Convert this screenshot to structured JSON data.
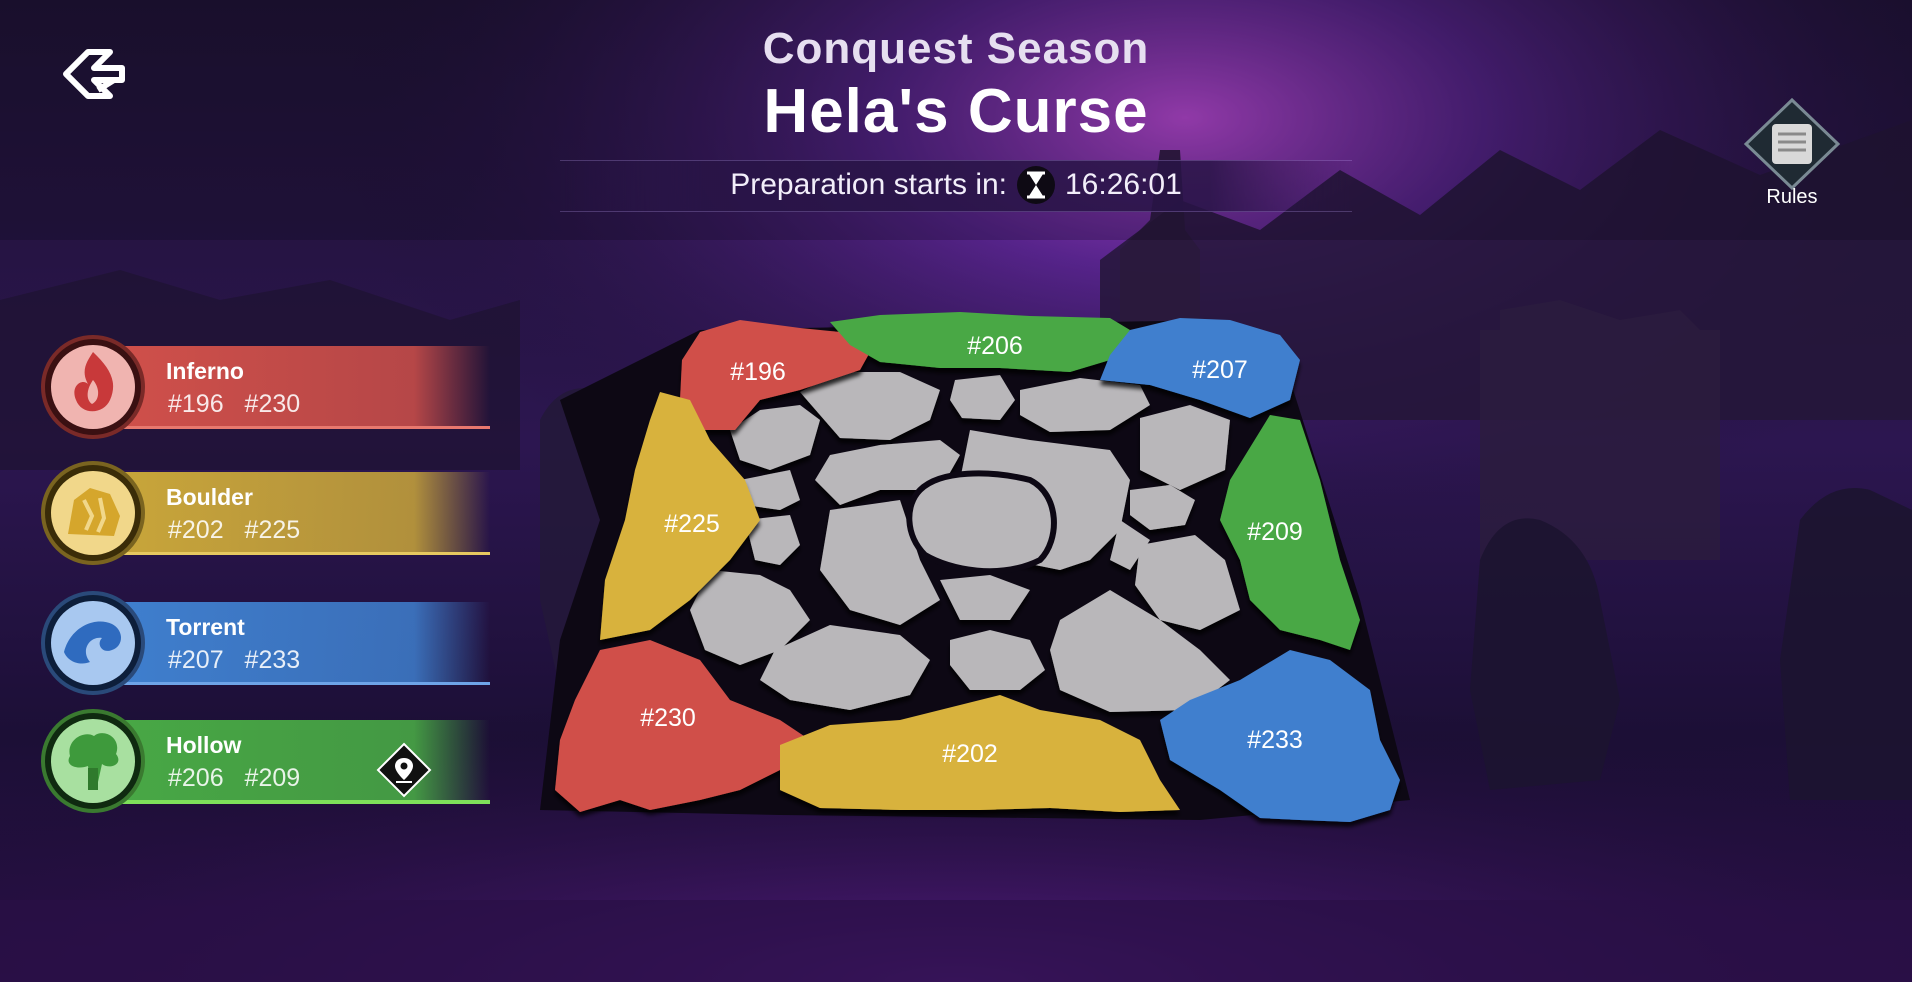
{
  "header": {
    "subtitle": "Conquest Season",
    "title": "Hela's Curse",
    "prep_label": "Preparation starts in:",
    "countdown": "16:26:01"
  },
  "rules": {
    "label": "Rules"
  },
  "factions": [
    {
      "name": "Inferno",
      "servers": "#196 #230",
      "color": "#d0504a",
      "icon": "flame-emblem-icon"
    },
    {
      "name": "Boulder",
      "servers": "#202 #225",
      "color": "#d8b23c",
      "icon": "rock-emblem-icon"
    },
    {
      "name": "Torrent",
      "servers": "#207 #233",
      "color": "#3f7fce",
      "icon": "wave-emblem-icon"
    },
    {
      "name": "Hollow",
      "servers": "#206 #209",
      "color": "#48a845",
      "icon": "tree-emblem-icon"
    }
  ],
  "map": {
    "regions": [
      {
        "id": "#196",
        "faction": "Inferno"
      },
      {
        "id": "#206",
        "faction": "Hollow"
      },
      {
        "id": "#207",
        "faction": "Torrent"
      },
      {
        "id": "#225",
        "faction": "Boulder"
      },
      {
        "id": "#209",
        "faction": "Hollow"
      },
      {
        "id": "#230",
        "faction": "Inferno"
      },
      {
        "id": "#202",
        "faction": "Boulder"
      },
      {
        "id": "#233",
        "faction": "Torrent"
      }
    ],
    "neutral_color": "#b9b7ba"
  }
}
